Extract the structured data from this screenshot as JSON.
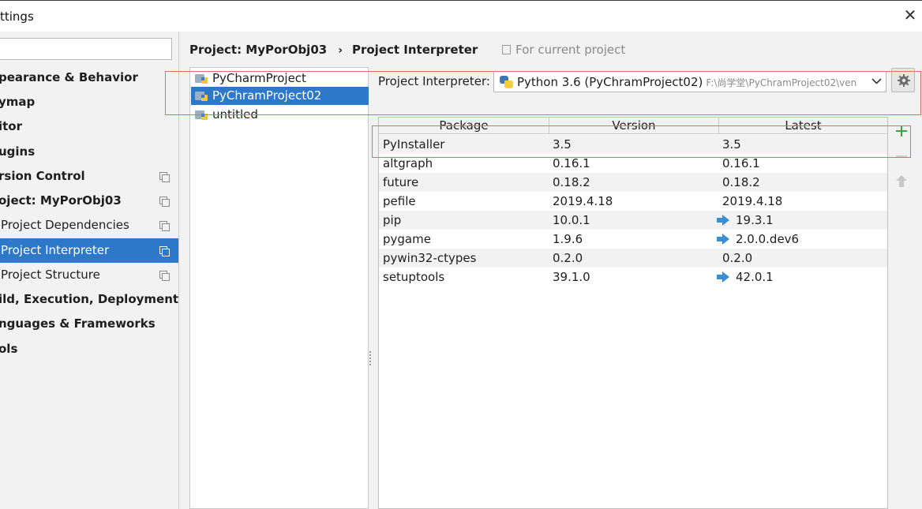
{
  "window": {
    "title": "ttings",
    "close_icon": "close-icon"
  },
  "sidebar": {
    "search_value": "",
    "items": [
      {
        "label": "pearance & Behavior",
        "bold": true
      },
      {
        "label": "ymap",
        "bold": true
      },
      {
        "label": "itor",
        "bold": true
      },
      {
        "label": "ugins",
        "bold": true
      },
      {
        "label": "rsion Control",
        "bold": true,
        "copy_icon": true
      },
      {
        "label": "oject: MyPorObj03",
        "bold": true,
        "copy_icon": true
      },
      {
        "label": "Project Dependencies",
        "bold": false,
        "copy_icon": true
      },
      {
        "label": "Project Interpreter",
        "bold": false,
        "copy_icon": true,
        "selected": true
      },
      {
        "label": "Project Structure",
        "bold": false,
        "copy_icon": true
      },
      {
        "label": "ild, Execution, Deployment",
        "bold": true
      },
      {
        "label": "nguages & Frameworks",
        "bold": true
      },
      {
        "label": "ols",
        "bold": true
      }
    ]
  },
  "breadcrumb": {
    "project": "Project: MyPorObj03",
    "separator": "›",
    "page": "Project Interpreter",
    "scope": "For current project"
  },
  "projects": [
    {
      "label": "PyCharmProject"
    },
    {
      "label": "PyChramProject02",
      "selected": true
    },
    {
      "label": "untitled"
    }
  ],
  "interpreter": {
    "label": "Project Interpreter:",
    "value": "Python 3.6 (PyChramProject02)",
    "path": "F:\\尚学堂\\PyChramProject02\\ven",
    "settings_icon": "gear-icon"
  },
  "packages": {
    "columns": [
      "Package",
      "Version",
      "Latest"
    ],
    "rows": [
      {
        "package": "PyInstaller",
        "version": "3.5",
        "latest": "3.5",
        "upgrade": false
      },
      {
        "package": "altgraph",
        "version": "0.16.1",
        "latest": "0.16.1",
        "upgrade": false
      },
      {
        "package": "future",
        "version": "0.18.2",
        "latest": "0.18.2",
        "upgrade": false
      },
      {
        "package": "pefile",
        "version": "2019.4.18",
        "latest": "2019.4.18",
        "upgrade": false
      },
      {
        "package": "pip",
        "version": "10.0.1",
        "latest": "19.3.1",
        "upgrade": true
      },
      {
        "package": "pygame",
        "version": "1.9.6",
        "latest": "2.0.0.dev6",
        "upgrade": true
      },
      {
        "package": "pywin32-ctypes",
        "version": "0.2.0",
        "latest": "0.2.0",
        "upgrade": false
      },
      {
        "package": "setuptools",
        "version": "39.1.0",
        "latest": "42.0.1",
        "upgrade": true
      }
    ]
  },
  "toolbar": {
    "add_icon": "plus-icon",
    "remove_icon": "minus-icon",
    "upgrade_icon": "arrow-up-icon"
  },
  "colors": {
    "selection": "#2d78c8",
    "annotation": "#e06b6b",
    "add": "#3aa53e",
    "upgrade_arrow": "#3a8fd0"
  }
}
